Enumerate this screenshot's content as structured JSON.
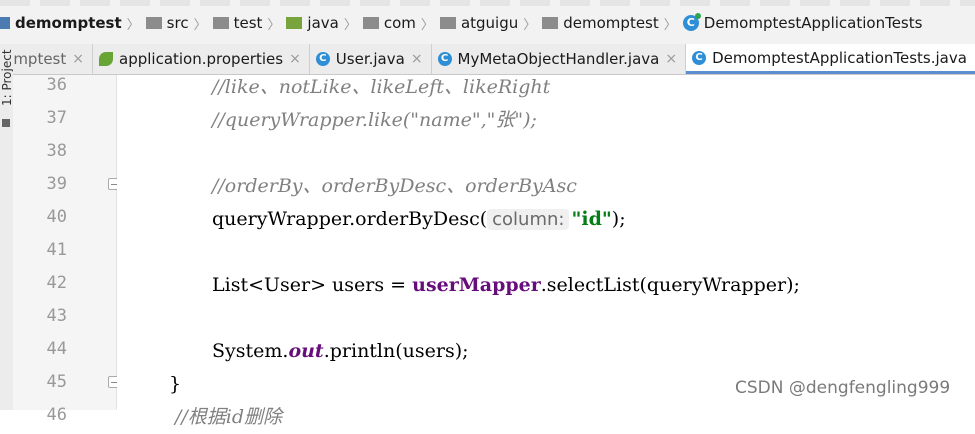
{
  "breadcrumb": [
    {
      "label": "demomptest",
      "icon": "module-folder-icon",
      "bold": true
    },
    {
      "label": "src",
      "icon": "folder-icon"
    },
    {
      "label": "test",
      "icon": "folder-icon"
    },
    {
      "label": "java",
      "icon": "test-source-folder-icon"
    },
    {
      "label": "com",
      "icon": "package-icon"
    },
    {
      "label": "atguigu",
      "icon": "package-icon"
    },
    {
      "label": "demomptest",
      "icon": "package-icon"
    },
    {
      "label": "DemomptestApplicationTests",
      "icon": "test-class-icon"
    }
  ],
  "tabs": [
    {
      "label": "mptest",
      "icon": "module-icon",
      "close": "×"
    },
    {
      "label": "application.properties",
      "icon": "spring-properties-icon",
      "close": "×"
    },
    {
      "label": "User.java",
      "icon": "class-icon",
      "close": "×"
    },
    {
      "label": "MyMetaObjectHandler.java",
      "icon": "class-icon",
      "close": "×"
    },
    {
      "label": "DemomptestApplicationTests.java",
      "icon": "test-class-icon",
      "close": "×",
      "active": true
    }
  ],
  "sidebar": {
    "project_label": "1: Project"
  },
  "editor": {
    "line_numbers": [
      "36",
      "37",
      "38",
      "39",
      "40",
      "41",
      "42",
      "43",
      "44",
      "45",
      "46"
    ],
    "lines": {
      "l36": "//like、notLike、likeLeft、likeRight",
      "l37": "//queryWrapper.like(\"name\",\"张\");",
      "l39": "//orderBy、orderByDesc、orderByAsc",
      "l40_a": "queryWrapper.orderByDesc(",
      "l40_hint": "column:",
      "l40_str": "\"id\"",
      "l40_b": ");",
      "l42_a": "List<User> users = ",
      "l42_field": "userMapper",
      "l42_b": ".selectList(queryWrapper);",
      "l44_a": "System.",
      "l44_static": "out",
      "l44_b": ".println(users);",
      "l45": "}",
      "l46": "//根据id删除"
    }
  },
  "watermark": "CSDN @dengfengling999",
  "colors": {
    "comment": "#808080",
    "field": "#660e7a",
    "string": "#067d17",
    "tab_active_underline": "#5b8fd0"
  }
}
